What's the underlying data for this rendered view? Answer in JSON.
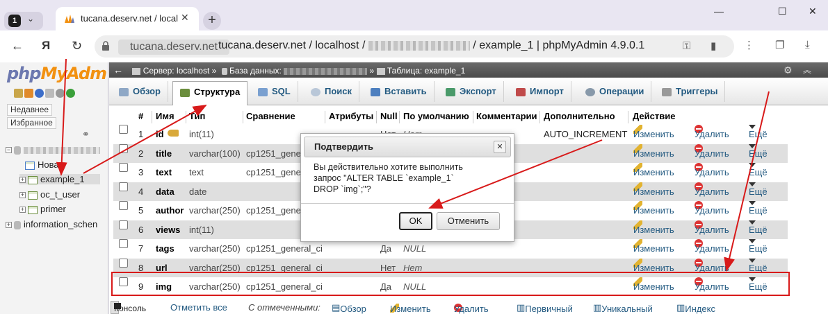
{
  "browser": {
    "tab_count": "1",
    "tab_title": "tucana.deserv.net / localhost",
    "url_host": "tucana.deserv.net",
    "url_path_start": "tucana.deserv.net / localhost /",
    "url_path_end": "/ example_1 | phpMyAdmin 4.9.0.1"
  },
  "sidebar": {
    "logo_php": "php",
    "logo_my": "MyAdm",
    "recent_label": "Недавнее",
    "favorites_label": "Избранное",
    "tree": {
      "new_label": "Новая",
      "tables": [
        "example_1",
        "oc_t_user",
        "primer"
      ],
      "info_schema": "information_schen"
    }
  },
  "breadcrumb": {
    "server": "Сервер: localhost »",
    "database": "База данных:",
    "table": "Таблица: example_1"
  },
  "tabs": [
    "Обзор",
    "Структура",
    "SQL",
    "Поиск",
    "Вставить",
    "Экспорт",
    "Импорт",
    "Операции",
    "Триггеры"
  ],
  "table": {
    "headers": [
      "#",
      "Имя",
      "Тип",
      "Сравнение",
      "Атрибуты",
      "Null",
      "По умолчанию",
      "Комментарии",
      "Дополнительно",
      "Действие"
    ],
    "rows": [
      {
        "num": "1",
        "name": "id",
        "type": "int(11)",
        "collation": "",
        "null": "Нет",
        "default": "Нет",
        "extra": "AUTO_INCREMENT"
      },
      {
        "num": "2",
        "name": "title",
        "type": "varchar(100)",
        "collation": "cp1251_gene",
        "null": "",
        "default": "",
        "extra": ""
      },
      {
        "num": "3",
        "name": "text",
        "type": "text",
        "collation": "cp1251_gene",
        "null": "",
        "default": "",
        "extra": ""
      },
      {
        "num": "4",
        "name": "data",
        "type": "date",
        "collation": "",
        "null": "",
        "default": "",
        "extra": ""
      },
      {
        "num": "5",
        "name": "author",
        "type": "varchar(250)",
        "collation": "cp1251_gene",
        "null": "",
        "default": "",
        "extra": ""
      },
      {
        "num": "6",
        "name": "views",
        "type": "int(11)",
        "collation": "",
        "null": "",
        "default": "",
        "extra": ""
      },
      {
        "num": "7",
        "name": "tags",
        "type": "varchar(250)",
        "collation": "cp1251_general_ci",
        "null": "Да",
        "default": "NULL",
        "extra": ""
      },
      {
        "num": "8",
        "name": "url",
        "type": "varchar(250)",
        "collation": "cp1251_general_ci",
        "null": "Нет",
        "default": "Нет",
        "extra": ""
      },
      {
        "num": "9",
        "name": "img",
        "type": "varchar(250)",
        "collation": "cp1251_general_ci",
        "null": "Да",
        "default": "NULL",
        "extra": ""
      }
    ],
    "actions": {
      "edit": "Изменить",
      "delete": "Удалить",
      "more": "Ещё"
    }
  },
  "bottom": {
    "console": "Консоль",
    "check_all": "Отметить все",
    "with_selected": "С отмеченными:",
    "browse": "Обзор",
    "edit": "Изменить",
    "delete": "Удалить",
    "primary": "Первичный",
    "unique": "Уникальный",
    "index": "Индекс"
  },
  "dialog": {
    "title": "Подтвердить",
    "close": "✕",
    "line1": "Вы действительно хотите выполнить",
    "line2": "запрос \"ALTER TABLE `example_1`",
    "line3": "DROP `img`;\"?",
    "ok": "OK",
    "cancel": "Отменить"
  },
  "colors": {
    "annotation_red": "#d81a1a",
    "link_blue": "#235a81"
  }
}
